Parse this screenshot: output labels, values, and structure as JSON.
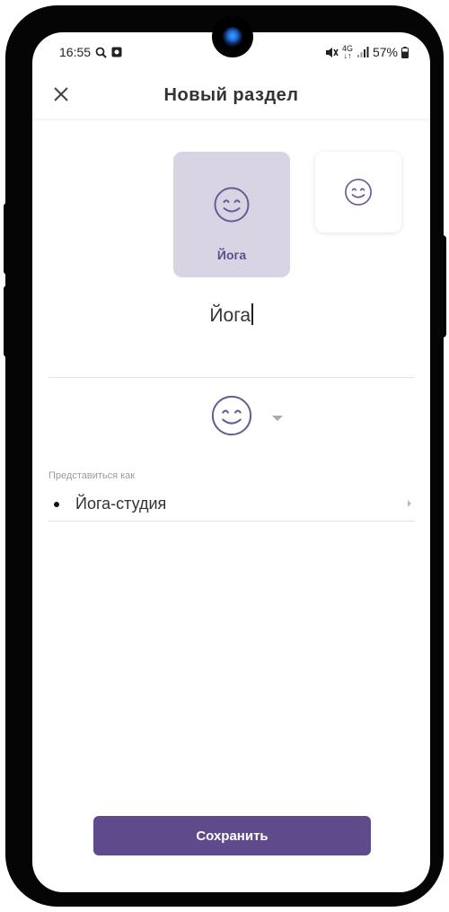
{
  "status_bar": {
    "time": "16:55",
    "network_top": "4G",
    "network_bottom": "↓↑",
    "battery": "57%"
  },
  "header": {
    "title": "Новый раздел",
    "close_icon": "close-icon"
  },
  "tiles": {
    "selected_label": "Йога"
  },
  "name_field": {
    "value": "Йога"
  },
  "identity": {
    "label": "Представиться как",
    "value": "Йога-студия"
  },
  "save_button": {
    "label": "Сохранить"
  },
  "colors": {
    "accent": "#5f4b8b",
    "tile_selected_bg": "#d9d4e4",
    "icon_color": "#6b5b95"
  }
}
